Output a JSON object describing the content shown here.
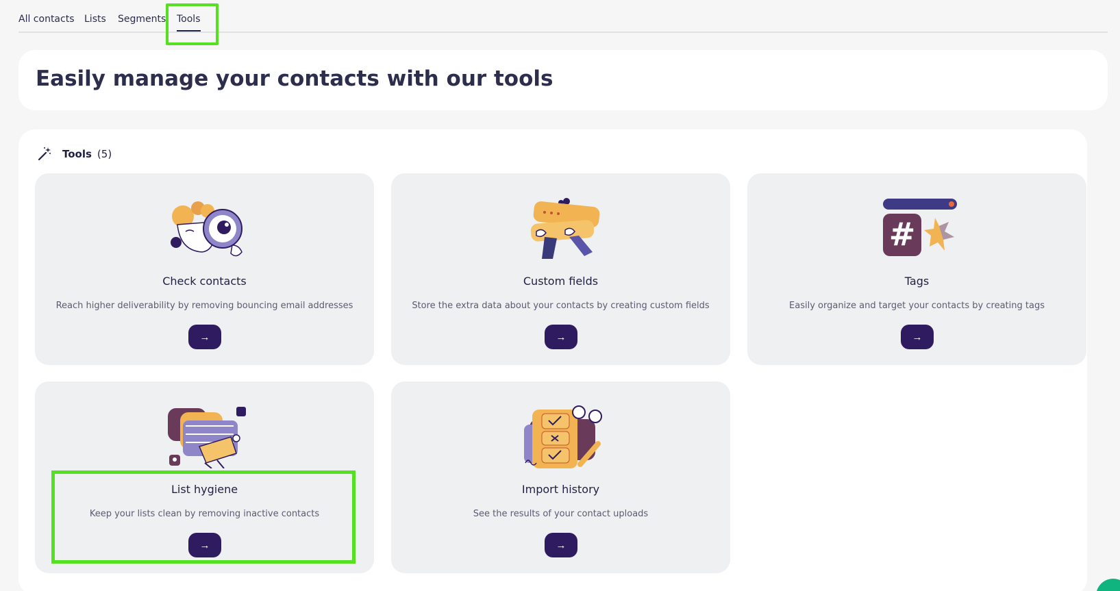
{
  "tabs": [
    {
      "label": "All contacts",
      "active": false
    },
    {
      "label": "Lists",
      "active": false
    },
    {
      "label": "Segments",
      "active": false
    },
    {
      "label": "Tools",
      "active": true
    }
  ],
  "hero": {
    "title": "Easily manage your contacts with our tools"
  },
  "tools_section": {
    "title": "Tools",
    "count": "(5)",
    "icon": "magic-wand-icon"
  },
  "cards": [
    {
      "title": "Check contacts",
      "description": "Reach higher deliverability by removing bouncing email addresses",
      "button": "→",
      "illustration": "magnifier-face"
    },
    {
      "title": "Custom fields",
      "description": "Store the extra data about your contacts by creating custom fields",
      "button": "→",
      "illustration": "hands-holding-card"
    },
    {
      "title": "Tags",
      "description": "Easily organize and target your contacts by creating tags",
      "button": "→",
      "illustration": "hashtag"
    },
    {
      "title": "List hygiene",
      "description": "Keep your lists clean by removing inactive contacts",
      "button": "→",
      "illustration": "cleaning-cards"
    },
    {
      "title": "Import history",
      "description": "See the results of your contact uploads",
      "button": "→",
      "illustration": "checklist-pencil"
    }
  ],
  "colors": {
    "accent": "#2f1b60",
    "highlight": "#55e021",
    "card_bg": "#eff0f2",
    "chat": "#10b47f"
  }
}
